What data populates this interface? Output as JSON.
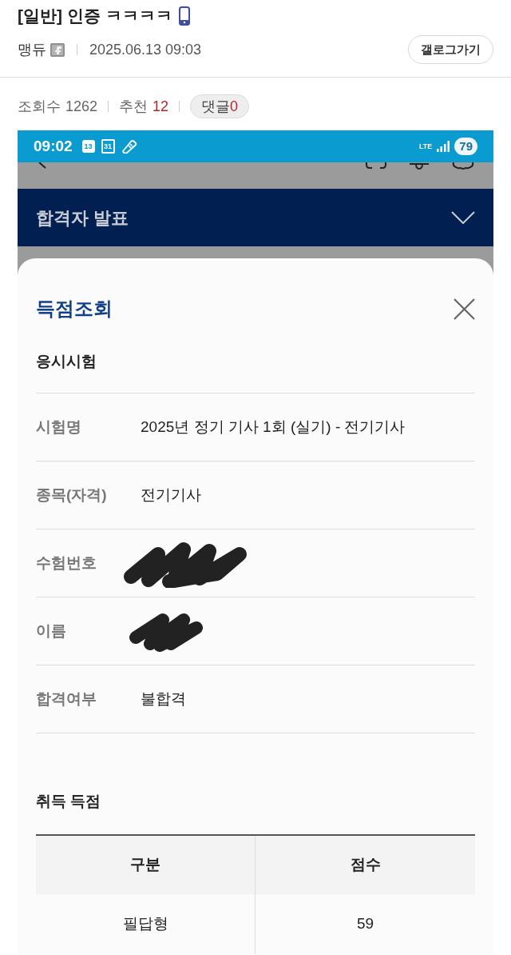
{
  "post": {
    "title": "[일반] 인증 ㅋㅋㅋㅋ",
    "author": "맹듀",
    "date": "2025.06.13 09:03",
    "gallog_button": "갤로그가기"
  },
  "stats": [
    {
      "kind": "count",
      "label": "조회수",
      "value": "1262"
    },
    {
      "kind": "accent",
      "label": "추천",
      "value": "12"
    },
    {
      "kind": "pill",
      "label": "댓글",
      "value": "0"
    }
  ],
  "screenshot": {
    "status_bar": {
      "time": "09:02",
      "notification_icons": [
        {
          "kind": "calendar-filled",
          "label": "13"
        },
        {
          "kind": "calendar-outline",
          "label": "31"
        },
        {
          "kind": "pencil"
        }
      ],
      "network": "LTE",
      "battery": "79"
    },
    "accordion": {
      "title": "합격자 발표",
      "expanded": false
    },
    "sheet": {
      "title": "득점조회",
      "section_title": "응시시험",
      "fields": [
        {
          "label": "시험명",
          "kind": "text",
          "value": "2025년 정기 기사 1회 (실기) - 전기기사"
        },
        {
          "label": "종목(자격)",
          "kind": "text",
          "value": "전기기사"
        },
        {
          "label": "수험번호",
          "kind": "redacted"
        },
        {
          "label": "이름",
          "kind": "redacted"
        },
        {
          "label": "합격여부",
          "kind": "text",
          "value": "불합격"
        }
      ],
      "score_title": "취득 득점",
      "score_table": {
        "columns": [
          "구분",
          "점수"
        ],
        "rows": [
          [
            "필답형",
            "59"
          ]
        ]
      }
    }
  }
}
